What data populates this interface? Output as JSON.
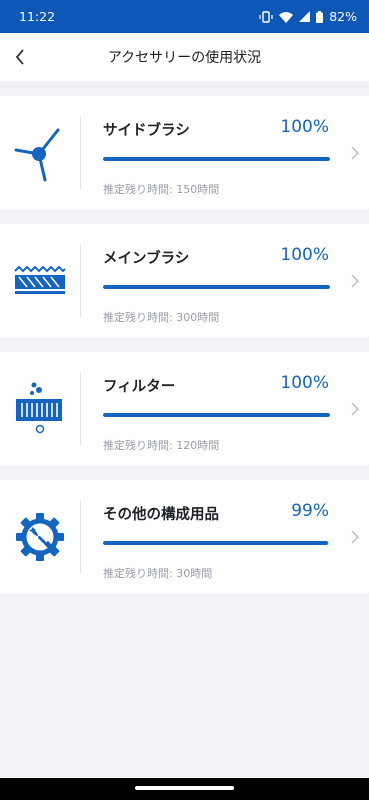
{
  "status_bar": {
    "time": "11:22",
    "battery": "82%",
    "icons": [
      "vibrate-icon",
      "wifi-icon",
      "signal-icon",
      "battery-icon"
    ]
  },
  "header": {
    "title": "アクセサリーの使用状況",
    "back_icon": "chevron-left-icon"
  },
  "colors": {
    "status_bar_bg": "#0d58b6",
    "accent": "#1565c0",
    "page_bg": "#f1f2f6"
  },
  "accessories": [
    {
      "name": "サイドブラシ",
      "percent": "100%",
      "level": 1.0,
      "remaining": "推定残り時間: 150時間",
      "icon": "side-brush-icon"
    },
    {
      "name": "メインブラシ",
      "percent": "100%",
      "level": 1.0,
      "remaining": "推定残り時間: 300時間",
      "icon": "main-brush-icon"
    },
    {
      "name": "フィルター",
      "percent": "100%",
      "level": 1.0,
      "remaining": "推定残り時間: 120時間",
      "icon": "filter-icon"
    },
    {
      "name": "その他の構成用品",
      "percent": "99%",
      "level": 0.99,
      "remaining": "推定残り時間: 30時間",
      "icon": "gear-wrench-icon"
    }
  ]
}
